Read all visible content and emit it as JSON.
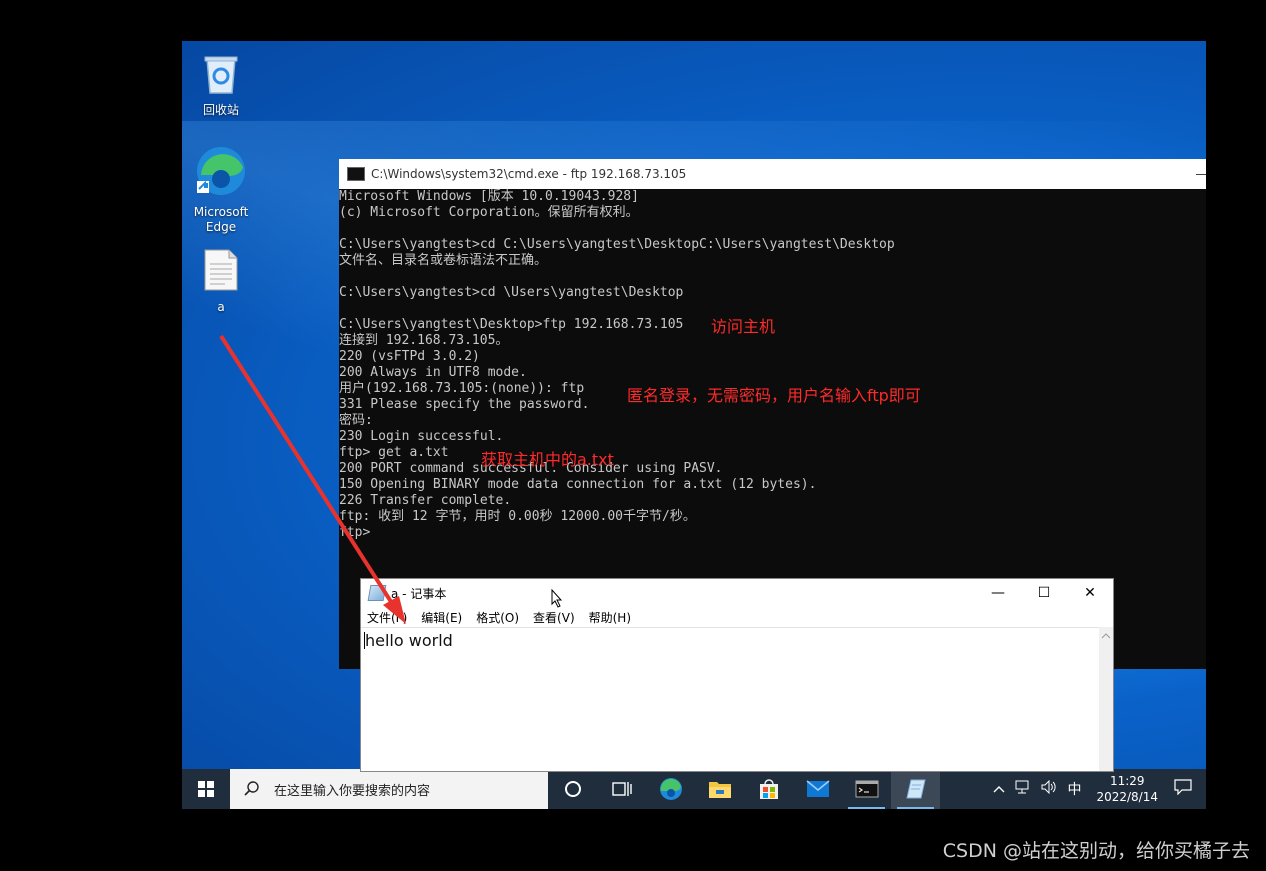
{
  "desktop": {
    "icons": [
      {
        "label": "回收站",
        "icon": "recycle-bin-icon"
      },
      {
        "label": "Microsoft\nEdge",
        "icon": "edge-icon"
      },
      {
        "label": "a",
        "icon": "text-file-icon"
      }
    ]
  },
  "cmd": {
    "title": "C:\\Windows\\system32\\cmd.exe - ftp  192.168.73.105",
    "lines": [
      "Microsoft Windows [版本 10.0.19043.928]",
      "(c) Microsoft Corporation。保留所有权利。",
      "",
      "C:\\Users\\yangtest>cd C:\\Users\\yangtest\\DesktopC:\\Users\\yangtest\\Desktop",
      "文件名、目录名或卷标语法不正确。",
      "",
      "C:\\Users\\yangtest>cd \\Users\\yangtest\\Desktop",
      "",
      "C:\\Users\\yangtest\\Desktop>ftp 192.168.73.105",
      "连接到 192.168.73.105。",
      "220 (vsFTPd 3.0.2)",
      "200 Always in UTF8 mode.",
      "用户(192.168.73.105:(none)): ftp",
      "331 Please specify the password.",
      "密码:",
      "230 Login successful.",
      "ftp> get a.txt",
      "200 PORT command successful. Consider using PASV.",
      "150 Opening BINARY mode data connection for a.txt (12 bytes).",
      "226 Transfer complete.",
      "ftp: 收到 12 字节，用时 0.00秒 12000.00千字节/秒。",
      "ftp>"
    ]
  },
  "annotations": {
    "access_host": "访问主机",
    "anonymous_login": "匿名登录，无需密码，用户名输入ftp即可",
    "get_file": "获取主机中的a.txt"
  },
  "notepad": {
    "title": "a - 记事本",
    "menu": [
      "文件(F)",
      "编辑(E)",
      "格式(O)",
      "查看(V)",
      "帮助(H)"
    ],
    "content": "hello world",
    "controls": {
      "minimize": "—",
      "maximize": "☐",
      "close": "✕"
    }
  },
  "taskbar": {
    "search_placeholder": "在这里输入你要搜索的内容",
    "apps": [
      "cortana-icon",
      "task-view-icon",
      "edge-icon",
      "file-explorer-icon",
      "store-icon",
      "mail-icon",
      "cmd-icon",
      "notepad-icon"
    ],
    "tray": {
      "ime": "中",
      "time": "11:29",
      "date": "2022/8/14"
    }
  },
  "watermark": "CSDN @站在这别动，给你买橘子去",
  "colors": {
    "annotation": "#ff2a2a",
    "taskbar": "#1f2d3d",
    "console_bg": "#0c0c0c"
  }
}
